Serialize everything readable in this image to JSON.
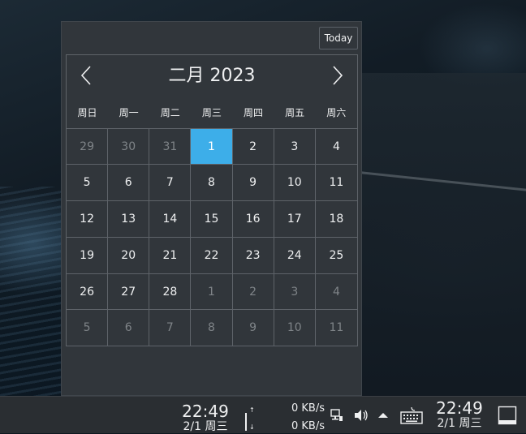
{
  "calendar": {
    "today_label": "Today",
    "month_title": "二月 2023",
    "weekdays": [
      "周日",
      "周一",
      "周二",
      "周三",
      "周四",
      "周五",
      "周六"
    ],
    "days": [
      {
        "label": "29",
        "state": "dim"
      },
      {
        "label": "30",
        "state": "dim"
      },
      {
        "label": "31",
        "state": "dim"
      },
      {
        "label": "1",
        "state": "selected"
      },
      {
        "label": "2",
        "state": "normal"
      },
      {
        "label": "3",
        "state": "normal"
      },
      {
        "label": "4",
        "state": "normal"
      },
      {
        "label": "5",
        "state": "normal"
      },
      {
        "label": "6",
        "state": "normal"
      },
      {
        "label": "7",
        "state": "normal"
      },
      {
        "label": "8",
        "state": "normal"
      },
      {
        "label": "9",
        "state": "normal"
      },
      {
        "label": "10",
        "state": "normal"
      },
      {
        "label": "11",
        "state": "normal"
      },
      {
        "label": "12",
        "state": "normal"
      },
      {
        "label": "13",
        "state": "normal"
      },
      {
        "label": "14",
        "state": "normal"
      },
      {
        "label": "15",
        "state": "normal"
      },
      {
        "label": "16",
        "state": "normal"
      },
      {
        "label": "17",
        "state": "normal"
      },
      {
        "label": "18",
        "state": "normal"
      },
      {
        "label": "19",
        "state": "normal"
      },
      {
        "label": "20",
        "state": "normal"
      },
      {
        "label": "21",
        "state": "normal"
      },
      {
        "label": "22",
        "state": "normal"
      },
      {
        "label": "23",
        "state": "normal"
      },
      {
        "label": "24",
        "state": "normal"
      },
      {
        "label": "25",
        "state": "normal"
      },
      {
        "label": "26",
        "state": "normal"
      },
      {
        "label": "27",
        "state": "normal"
      },
      {
        "label": "28",
        "state": "normal"
      },
      {
        "label": "1",
        "state": "dim"
      },
      {
        "label": "2",
        "state": "dim"
      },
      {
        "label": "3",
        "state": "dim"
      },
      {
        "label": "4",
        "state": "dim"
      },
      {
        "label": "5",
        "state": "dim"
      },
      {
        "label": "6",
        "state": "dim"
      },
      {
        "label": "7",
        "state": "dim"
      },
      {
        "label": "8",
        "state": "dim"
      },
      {
        "label": "9",
        "state": "dim"
      },
      {
        "label": "10",
        "state": "dim"
      },
      {
        "label": "11",
        "state": "dim"
      }
    ]
  },
  "taskbar": {
    "clock_left": {
      "time": "22:49",
      "date": "2/1 周三"
    },
    "net_up": "↑",
    "net_down": "↓",
    "upload_speed": "0 KB/s",
    "download_speed": "0 KB/s",
    "clock_right": {
      "time": "22:49",
      "date": "2/1 周三"
    },
    "icons": [
      "network-icon",
      "volume-icon",
      "expand-tray-icon",
      "keyboard-icon",
      "show-desktop-icon"
    ]
  },
  "colors": {
    "accent": "#3daee9",
    "panel": "#31363b",
    "text": "#eff0f1",
    "dim_text": "#7f8488"
  }
}
